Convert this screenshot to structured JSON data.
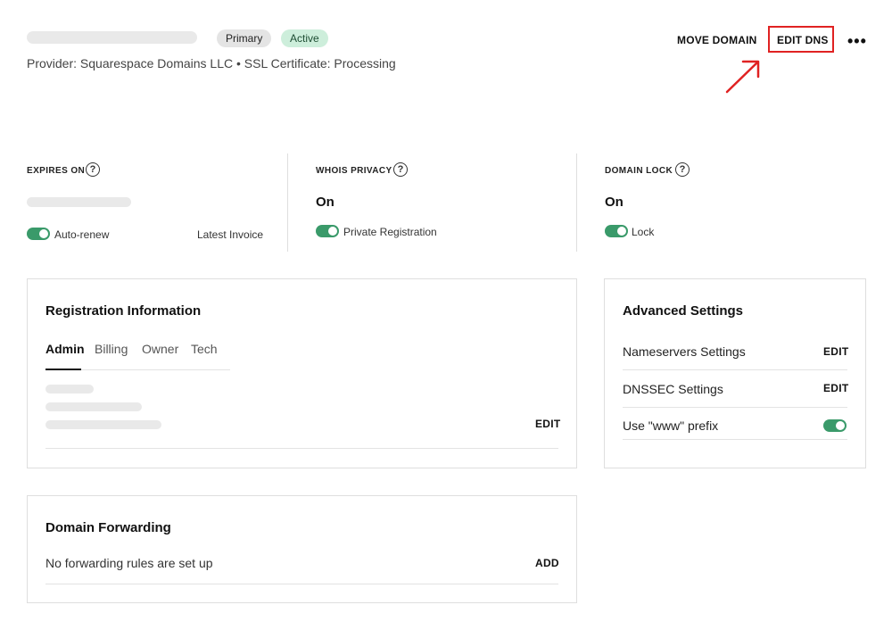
{
  "header": {
    "badges": {
      "primary": "Primary",
      "active": "Active"
    },
    "subtitle": "Provider: Squarespace Domains LLC • SSL Certificate: Processing",
    "actions": {
      "move_domain": "MOVE DOMAIN",
      "edit_dns": "EDIT DNS",
      "more": "•••"
    }
  },
  "stats": {
    "expires": {
      "label": "EXPIRES ON",
      "toggle_label": "Auto-renew",
      "toggle_on": true,
      "link": "Latest Invoice"
    },
    "whois": {
      "label": "WHOIS PRIVACY",
      "value": "On",
      "toggle_label": "Private Registration",
      "toggle_on": true
    },
    "lock": {
      "label": "DOMAIN LOCK",
      "value": "On",
      "toggle_label": "Lock",
      "toggle_on": true
    }
  },
  "registration": {
    "title": "Registration Information",
    "tabs": [
      "Admin",
      "Billing",
      "Owner",
      "Tech"
    ],
    "active_tab": "Admin",
    "edit": "EDIT"
  },
  "advanced": {
    "title": "Advanced Settings",
    "rows": [
      {
        "label": "Nameservers Settings",
        "action": "EDIT"
      },
      {
        "label": "DNSSEC Settings",
        "action": "EDIT"
      },
      {
        "label": "Use \"www\" prefix",
        "toggle_on": true
      }
    ]
  },
  "forwarding": {
    "title": "Domain Forwarding",
    "empty_text": "No forwarding rules are set up",
    "add": "ADD"
  },
  "colors": {
    "toggle": "#3a9a6a",
    "highlight": "#e02222",
    "active_badge": "#cdeedb"
  }
}
